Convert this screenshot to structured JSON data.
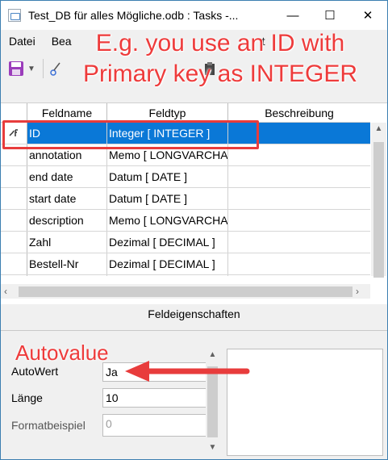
{
  "window": {
    "title": "Test_DB für alles Mögliche.odb : Tasks -...",
    "minimize_glyph": "—",
    "maximize_glyph": "☐",
    "close_glyph": "✕"
  },
  "menu": {
    "items": [
      "Datei",
      "Bea",
      "t"
    ]
  },
  "annotations": {
    "headline": "E.g. you use an ID with Primary key as INTEGER",
    "autovalue": "Autovalue",
    "highlight_color": "#e83c3c"
  },
  "grid": {
    "columns": [
      "Feldname",
      "Feldtyp",
      "Beschreibung"
    ],
    "rows": [
      {
        "name": "ID",
        "type": "Integer [ INTEGER ]",
        "description": "",
        "primary_key": true,
        "selected": true
      },
      {
        "name": "annotation",
        "type": "Memo [ LONGVARCHA",
        "description": ""
      },
      {
        "name": "end date",
        "type": "Datum [ DATE ]",
        "description": ""
      },
      {
        "name": "start date",
        "type": "Datum [ DATE ]",
        "description": ""
      },
      {
        "name": "description",
        "type": "Memo [ LONGVARCHA",
        "description": ""
      },
      {
        "name": "Zahl",
        "type": "Dezimal [ DECIMAL ]",
        "description": ""
      },
      {
        "name": "Bestell-Nr",
        "type": "Dezimal [ DECIMAL ]",
        "description": ""
      },
      {
        "name": "",
        "type": "",
        "description": ""
      }
    ],
    "selection_color": "#0a78d7"
  },
  "properties": {
    "title": "Feldeigenschaften",
    "fields": [
      {
        "label": "AutoWert",
        "value": "Ja",
        "disabled": false
      },
      {
        "label": "Länge",
        "value": "10",
        "disabled": false
      },
      {
        "label": "Formatbeispiel",
        "value": "0",
        "disabled": true
      }
    ]
  }
}
